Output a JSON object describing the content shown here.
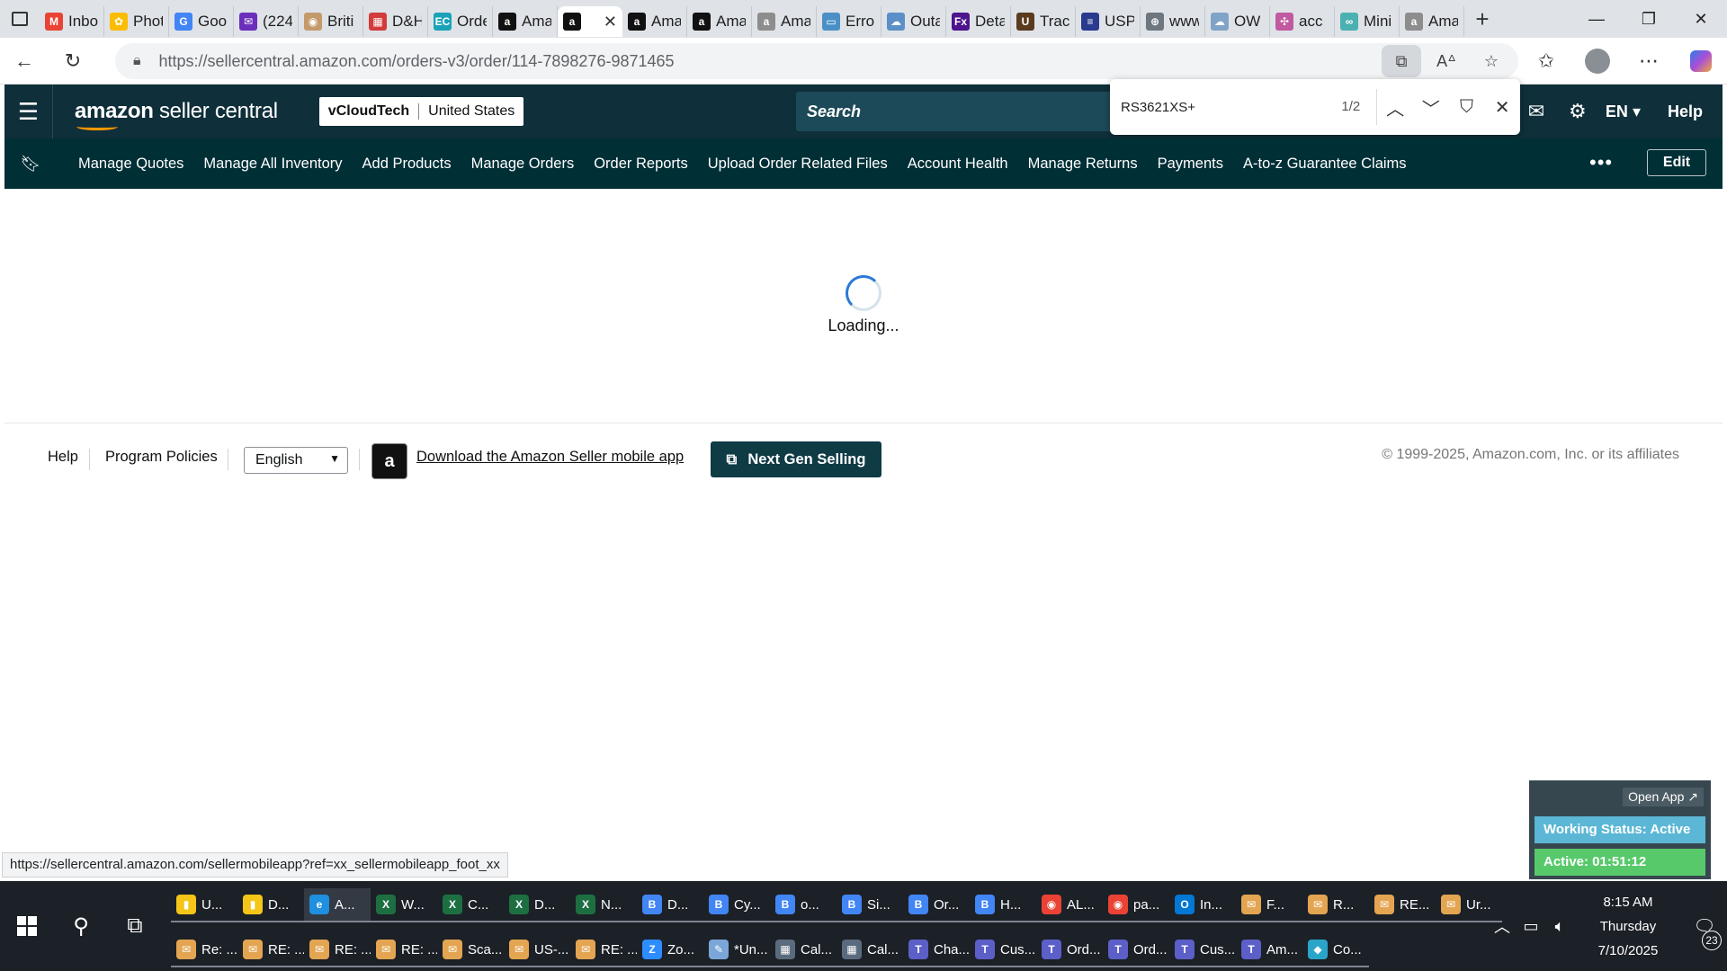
{
  "browser": {
    "tabs": [
      {
        "title": "Inbo",
        "icon": "gmail-icon",
        "color": "#ea4335",
        "glyph": "M"
      },
      {
        "title": "Phot",
        "icon": "photos-icon",
        "color": "#fbbc04",
        "glyph": "✿"
      },
      {
        "title": "Goo",
        "icon": "google-icon",
        "color": "#4285f4",
        "glyph": "G"
      },
      {
        "title": "(224",
        "icon": "mail-icon",
        "color": "#6b2fbb",
        "glyph": "✉"
      },
      {
        "title": "Briti",
        "icon": "crest-icon",
        "color": "#c49a6c",
        "glyph": "◉"
      },
      {
        "title": "D&H",
        "icon": "dh-icon",
        "color": "#d33b3b",
        "glyph": "▦"
      },
      {
        "title": "Orde",
        "icon": "ec-icon",
        "color": "#1aa3b8",
        "glyph": "EC"
      },
      {
        "title": "Ama",
        "icon": "amazon-icon",
        "color": "#111111",
        "glyph": "a"
      },
      {
        "title": "",
        "icon": "amazon-icon",
        "color": "#111111",
        "glyph": "a",
        "active": true
      },
      {
        "title": "Ama",
        "icon": "amazon-icon",
        "color": "#111111",
        "glyph": "a"
      },
      {
        "title": "Ama",
        "icon": "amazon-icon",
        "color": "#111111",
        "glyph": "a"
      },
      {
        "title": "Ama",
        "icon": "amazon-icon",
        "color": "#8d8d8d",
        "glyph": "a"
      },
      {
        "title": "Erro",
        "icon": "dell-icon",
        "color": "#4a90c6",
        "glyph": "▭"
      },
      {
        "title": "Outa",
        "icon": "cloud-icon",
        "color": "#5b8fc8",
        "glyph": "☁"
      },
      {
        "title": "Deta",
        "icon": "fedex-icon",
        "color": "#4d148c",
        "glyph": "Fx"
      },
      {
        "title": "Trac",
        "icon": "ups-icon",
        "color": "#5a3b1e",
        "glyph": "U"
      },
      {
        "title": "USP",
        "icon": "usps-icon",
        "color": "#2a3a8f",
        "glyph": "≡"
      },
      {
        "title": "www",
        "icon": "globe-icon",
        "color": "#6e7780",
        "glyph": "⊕"
      },
      {
        "title": "OW",
        "icon": "cloud-icon",
        "color": "#7fa4c8",
        "glyph": "☁"
      },
      {
        "title": "acc",
        "icon": "teams-icon",
        "color": "#c15aa0",
        "glyph": "✣"
      },
      {
        "title": "Mini",
        "icon": "link-icon",
        "color": "#4ab0b0",
        "glyph": "∞"
      },
      {
        "title": "Ama",
        "icon": "amazon-icon",
        "color": "#8d8d8d",
        "glyph": "a"
      }
    ],
    "url_host": "https://sellercentral.amazon.com",
    "url_path": "/orders-v3/order/114-7898276-9871465"
  },
  "header": {
    "logo_main": "amazon",
    "logo_sub": "seller central",
    "seller_name": "vCloudTech",
    "region": "United States",
    "search_placeholder": "Search",
    "language": "EN",
    "help": "Help"
  },
  "findbar": {
    "query": "RS3621XS+",
    "count": "1/2"
  },
  "nav": {
    "items": [
      "Manage Quotes",
      "Manage All Inventory",
      "Add Products",
      "Manage Orders",
      "Order Reports",
      "Upload Order Related Files",
      "Account Health",
      "Manage Returns",
      "Payments",
      "A-to-z Guarantee Claims"
    ],
    "more": "•••",
    "edit": "Edit"
  },
  "main": {
    "loading": "Loading..."
  },
  "footer": {
    "help": "Help",
    "policies": "Program Policies",
    "language": "English",
    "mobile_app": "Download the Amazon Seller mobile app",
    "next_gen": "Next Gen Selling",
    "copyright": "© 1999-2025, Amazon.com, Inc. or its affiliates"
  },
  "widget": {
    "open_app": "Open App ↗",
    "status": "Working Status: Active",
    "active_time": "Active: 01:51:12"
  },
  "status_url": "https://sellercentral.amazon.com/sellermobileapp?ref=xx_sellermobileapp_foot_xx",
  "taskbar": {
    "row1": [
      {
        "label": "U...",
        "color": "#f5c518",
        "glyph": "▮"
      },
      {
        "label": "D...",
        "color": "#f5c518",
        "glyph": "▮"
      },
      {
        "label": "A...",
        "color": "#1f8fe0",
        "glyph": "e",
        "active": true
      },
      {
        "label": "W...",
        "color": "#1d6f42",
        "glyph": "X"
      },
      {
        "label": "C...",
        "color": "#1d6f42",
        "glyph": "X"
      },
      {
        "label": "D...",
        "color": "#1d6f42",
        "glyph": "X"
      },
      {
        "label": "N...",
        "color": "#1d6f42",
        "glyph": "X"
      },
      {
        "label": "D...",
        "color": "#4285f4",
        "glyph": "B"
      },
      {
        "label": "Cy...",
        "color": "#4285f4",
        "glyph": "B"
      },
      {
        "label": "o...",
        "color": "#4285f4",
        "glyph": "B"
      },
      {
        "label": "Si...",
        "color": "#4285f4",
        "glyph": "B"
      },
      {
        "label": "Or...",
        "color": "#4285f4",
        "glyph": "B"
      },
      {
        "label": "H...",
        "color": "#4285f4",
        "glyph": "B"
      },
      {
        "label": "AL...",
        "color": "#ea4335",
        "glyph": "◉"
      },
      {
        "label": "pa...",
        "color": "#ea4335",
        "glyph": "◉"
      },
      {
        "label": "In...",
        "color": "#0078d4",
        "glyph": "O"
      },
      {
        "label": "F...",
        "color": "#e3a552",
        "glyph": "✉"
      },
      {
        "label": "R...",
        "color": "#e3a552",
        "glyph": "✉"
      },
      {
        "label": "RE...",
        "color": "#e3a552",
        "glyph": "✉"
      },
      {
        "label": "Ur...",
        "color": "#e3a552",
        "glyph": "✉"
      }
    ],
    "row2": [
      {
        "label": "Re: ...",
        "color": "#e3a552",
        "glyph": "✉"
      },
      {
        "label": "RE: ...",
        "color": "#e3a552",
        "glyph": "✉"
      },
      {
        "label": "RE: ...",
        "color": "#e3a552",
        "glyph": "✉"
      },
      {
        "label": "RE: ...",
        "color": "#e3a552",
        "glyph": "✉"
      },
      {
        "label": "Sca...",
        "color": "#e3a552",
        "glyph": "✉"
      },
      {
        "label": "US-...",
        "color": "#e3a552",
        "glyph": "✉"
      },
      {
        "label": "RE: ...",
        "color": "#e3a552",
        "glyph": "✉"
      },
      {
        "label": "Zo...",
        "color": "#2d8cff",
        "glyph": "Z"
      },
      {
        "label": "*Un...",
        "color": "#7aa7d8",
        "glyph": "✎"
      },
      {
        "label": "Cal...",
        "color": "#5a6b7d",
        "glyph": "▦"
      },
      {
        "label": "Cal...",
        "color": "#5a6b7d",
        "glyph": "▦"
      },
      {
        "label": "Cha...",
        "color": "#5b5fc7",
        "glyph": "T"
      },
      {
        "label": "Cus...",
        "color": "#5b5fc7",
        "glyph": "T"
      },
      {
        "label": "Ord...",
        "color": "#5b5fc7",
        "glyph": "T"
      },
      {
        "label": "Ord...",
        "color": "#5b5fc7",
        "glyph": "T"
      },
      {
        "label": "Cus...",
        "color": "#5b5fc7",
        "glyph": "T"
      },
      {
        "label": "Am...",
        "color": "#5b5fc7",
        "glyph": "T"
      },
      {
        "label": "Co...",
        "color": "#2aa5c9",
        "glyph": "◆"
      }
    ],
    "time": "8:15 AM",
    "day": "Thursday",
    "date": "7/10/2025",
    "notifications": "23"
  }
}
